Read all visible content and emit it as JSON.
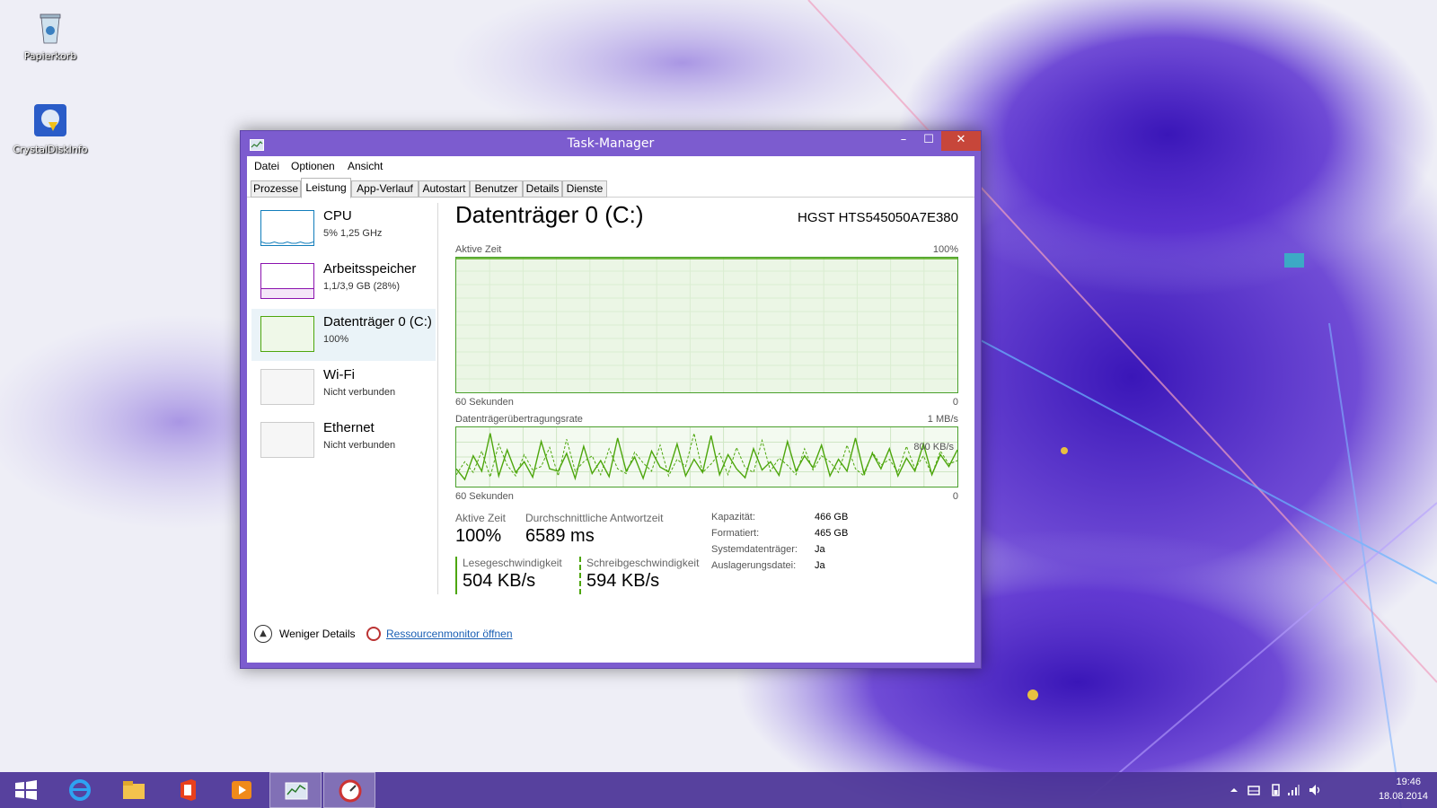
{
  "desktop": {
    "icons": [
      {
        "label": "Papierkorb",
        "icon": "recycle-bin-icon"
      },
      {
        "label": "CrystalDiskInfo",
        "icon": "crystaldiskinfo-icon"
      }
    ]
  },
  "window": {
    "title": "Task-Manager",
    "controls": {
      "minimize": "–",
      "maximize": "☐",
      "close": "✕"
    },
    "menu": [
      "Datei",
      "Optionen",
      "Ansicht"
    ],
    "tabs": [
      "Prozesse",
      "Leistung",
      "App-Verlauf",
      "Autostart",
      "Benutzer",
      "Details",
      "Dienste"
    ],
    "active_tab": "Leistung"
  },
  "sidebar": {
    "items": [
      {
        "name": "CPU",
        "sub": "5%  1,25 GHz",
        "color": "#117dbb"
      },
      {
        "name": "Arbeitsspeicher",
        "sub": "1,1/3,9 GB (28%)",
        "color": "#8b12ae"
      },
      {
        "name": "Datenträger 0 (C:)",
        "sub": "100%",
        "color": "#4da60c"
      },
      {
        "name": "Wi-Fi",
        "sub": "Nicht verbunden",
        "color": "#cccccc"
      },
      {
        "name": "Ethernet",
        "sub": "Nicht verbunden",
        "color": "#cccccc"
      }
    ],
    "selected": 2,
    "cpu_usage_percent": 5,
    "memory_usage_percent": 28,
    "disk_usage_percent": 100
  },
  "detail": {
    "title": "Datenträger 0 (C:)",
    "model": "HGST HTS545050A7E380",
    "graph1": {
      "label": "Aktive Zeit",
      "max": "100%",
      "time": "60 Sekunden",
      "min": "0",
      "value_percent": 100
    },
    "graph2": {
      "label": "Datenträgerübertragungsrate",
      "max": "1 MB/s",
      "mark": "800 KB/s",
      "time": "60 Sekunden",
      "min": "0"
    },
    "stats": {
      "active_time_label": "Aktive Zeit",
      "active_time": "100%",
      "response_label": "Durchschnittliche Antwortzeit",
      "response": "6589 ms",
      "read_label": "Lesegeschwindigkeit",
      "read": "504 KB/s",
      "write_label": "Schreibgeschwindigkeit",
      "write": "594 KB/s"
    },
    "properties": [
      {
        "label": "Kapazität:",
        "value": "466 GB"
      },
      {
        "label": "Formatiert:",
        "value": "465 GB"
      },
      {
        "label": "Systemdatenträger:",
        "value": "Ja"
      },
      {
        "label": "Auslagerungsdatei:",
        "value": "Ja"
      }
    ]
  },
  "transfer_rate_series": {
    "read_kbps": [
      300,
      120,
      520,
      260,
      900,
      180,
      620,
      240,
      420,
      160,
      760,
      300,
      260,
      560,
      140,
      680,
      220,
      440,
      170,
      820,
      260,
      500,
      140,
      600,
      330,
      250,
      720,
      180,
      460,
      240,
      860,
      200,
      540,
      300,
      150,
      640,
      280,
      420,
      190,
      760,
      260,
      520,
      320,
      700,
      180,
      460,
      260,
      820,
      220,
      560,
      300,
      640,
      180,
      480,
      260,
      720,
      200,
      540,
      340,
      620
    ],
    "write_kbps": [
      200,
      420,
      240,
      600,
      160,
      720,
      360,
      180,
      540,
      280,
      340,
      660,
      180,
      800,
      260,
      420,
      520,
      200,
      640,
      300,
      220,
      580,
      400,
      260,
      700,
      180,
      460,
      340,
      900,
      240,
      380,
      560,
      200,
      660,
      320,
      240,
      780,
      260,
      480,
      360,
      200,
      640,
      280,
      520,
      420,
      240,
      700,
      300,
      180,
      580,
      360,
      460,
      240,
      680,
      300,
      520,
      200,
      600,
      380,
      440
    ]
  },
  "footer": {
    "fewer_details": "Weniger Details",
    "resmon": "Ressourcenmonitor öffnen"
  },
  "taskbar": {
    "items": [
      "start-icon",
      "internet-explorer-icon",
      "file-explorer-icon",
      "office-icon",
      "media-player-icon",
      "task-manager-icon",
      "resource-monitor-icon"
    ],
    "active_index": 5,
    "time": "19:46",
    "date": "18.08.2014"
  }
}
